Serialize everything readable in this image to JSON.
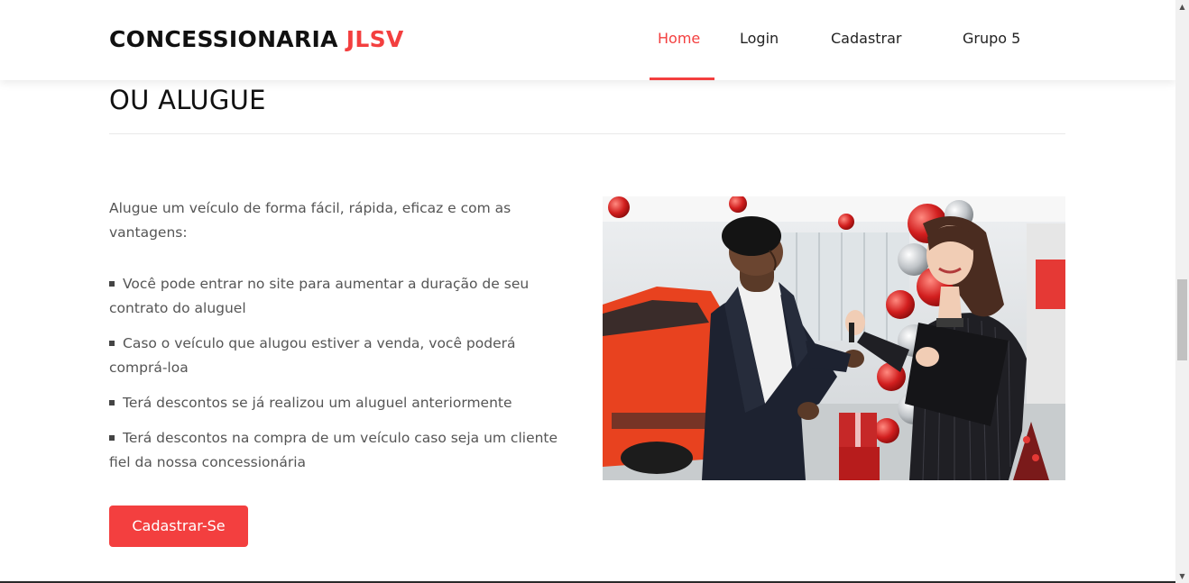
{
  "header": {
    "brand_main": "CONCESSIONARIA ",
    "brand_accent": "JLSV",
    "nav": [
      {
        "label": "Home",
        "active": true
      },
      {
        "label": "Login",
        "active": false
      },
      {
        "label": "Cadastrar",
        "active": false
      },
      {
        "label": "Grupo 5",
        "active": false
      }
    ]
  },
  "section": {
    "title": "OU ALUGUE",
    "intro": "Alugue um veículo de forma fácil, rápida, eficaz e com as vantagens:",
    "benefits": [
      "Você pode entrar no site para aumentar a duração de seu contrato do aluguel",
      "Caso o veículo que alugou estiver a venda, você poderá comprá-loa",
      "Terá descontos se já realizou um aluguel anteriormente",
      "Terá descontos na compra de um veículo caso seja um cliente fiel da nossa concessionária"
    ],
    "cta_label": "Cadastrar-Se"
  },
  "colors": {
    "accent": "#f33f3f",
    "text": "#555555",
    "heading": "#111111"
  },
  "icons": {
    "scroll_up": "chevron-up-icon",
    "scroll_down": "chevron-down-icon",
    "bullet": "square-bullet-icon"
  }
}
